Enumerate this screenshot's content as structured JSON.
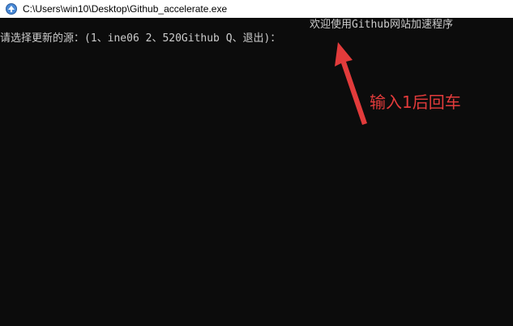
{
  "window": {
    "title": "C:\\Users\\win10\\Desktop\\Github_accelerate.exe",
    "icon": "console-app-icon"
  },
  "console": {
    "welcome": "欢迎使用Github网站加速程序",
    "prompt": "请选择更新的源：(1、ine06  2、520Github  Q、退出)："
  },
  "annotation": {
    "text": "输入1后回车",
    "color": "#e23b3b"
  }
}
